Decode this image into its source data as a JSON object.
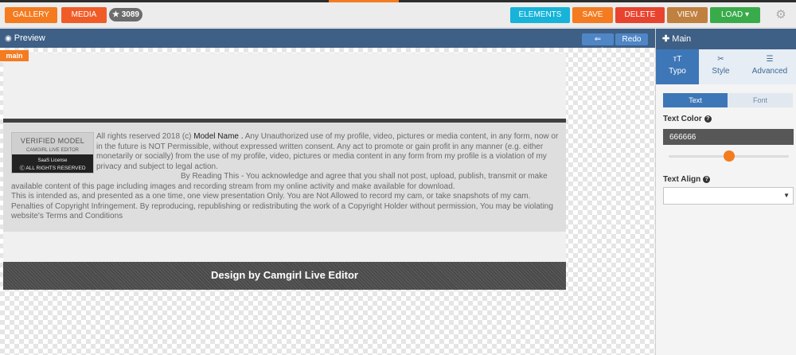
{
  "toolbar": {
    "gallery_label": "GALLERY",
    "media_label": "MEDIA",
    "badge_count": "★ 3089",
    "elements_label": "ELEMENTS",
    "save_label": "SAVE",
    "delete_label": "DELETE",
    "view_label": "VIEW",
    "load_label": "LOAD ▾",
    "settings_icon": "gear-icon",
    "colors": {
      "gallery": "#f47b20",
      "media": "#f05c28",
      "elements": "#17b3d8",
      "save": "#f47b20",
      "delete": "#e8432e",
      "view": "#c0803f",
      "load": "#3aab4b"
    }
  },
  "preview": {
    "title": "Preview",
    "icon": "eye-icon",
    "undo_label": "⇐ Undo",
    "redo_label": "Redo ⇒"
  },
  "canvas": {
    "section_tag": "main",
    "verified_badge": {
      "title": "VERIFIED MODEL",
      "subtitle": "CAMGIRL LIVE EDITOR",
      "license": "SaaS License",
      "rights": "Ⓒ ALL RIGHTS RESERVED"
    },
    "legal_text_1": "All rights reserved 2018 (c) ",
    "model_name": "Model Name .",
    "legal_text_2": " Any Unauthorized use of my profile, video, pictures or media content, in any form, now or in the future is NOT Permissible, without expressed written consent. Any act to promote or gain profit in any manner (e.g. either monetarily or socially) from the use of my profile, video, pictures or media content in any form from my profile is a violation of my privacy and subject to legal action.",
    "legal_text_3": "By Reading This - You acknowledge and agree that you shall not post, upload, publish, transmit or make available content of this page including images and recording stream from my online activity and make available for download.",
    "legal_text_4": "This is intended as, and presented as a one time, one view presentation Only. You are Not Allowed to record my cam, or take snapshots of my cam. Penalties of Copyright Infringement. By reproducing, republishing or redistributing the work of a Copyright Holder without permission, You may be violating website's Terms and Conditions",
    "footer_text": "Design by Camgirl Live Editor"
  },
  "panel": {
    "title": "Main",
    "tabs": [
      {
        "label": "Typo",
        "icon": "typography-icon",
        "active": true
      },
      {
        "label": "Style",
        "icon": "brush-icon"
      },
      {
        "label": "Advanced",
        "icon": "list-icon"
      }
    ],
    "segments": {
      "text_label": "Text",
      "font_label": "Font",
      "active": "Text"
    },
    "text_color_label": "Text Color",
    "text_color_value": "666666",
    "slider_value": 0.5,
    "text_align_label": "Text Align",
    "text_align_value": ""
  }
}
